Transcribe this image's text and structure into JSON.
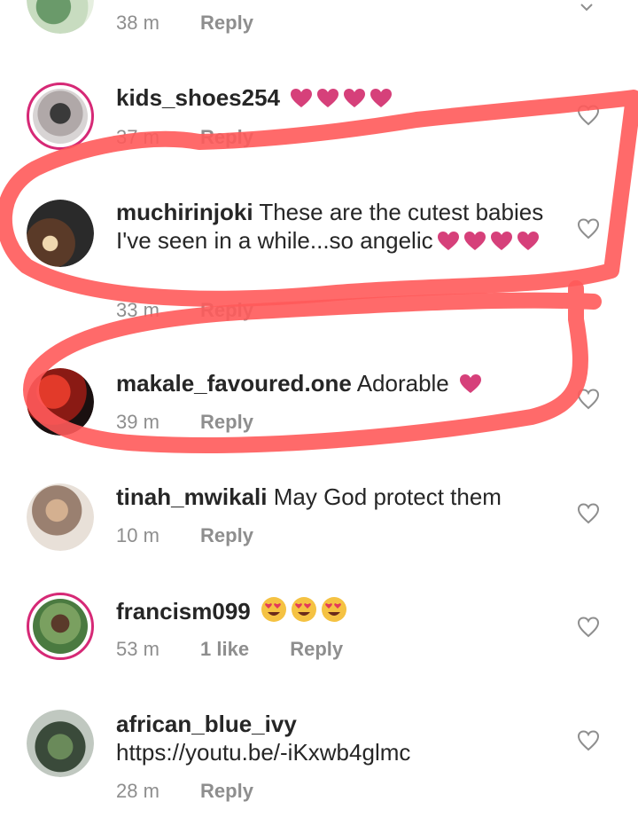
{
  "comments": [
    {
      "username": "",
      "text": "",
      "time": "38 m",
      "reply": "Reply",
      "likes": "",
      "avatar": "avatar-plant",
      "emojis": []
    },
    {
      "username": "kids_shoes254",
      "text": "",
      "time": "37 m",
      "reply": "Reply",
      "likes": "",
      "avatar": "avatar-shoes",
      "emojis": [
        "heart",
        "heart",
        "heart",
        "heart"
      ]
    },
    {
      "username": "muchirinjoki",
      "text": "These are the cutest babies I've seen in a while...so angelic",
      "time": "33 m",
      "reply": "Reply",
      "likes": "",
      "avatar": "avatar-hand",
      "emojis": [
        "heart",
        "heart",
        "heart",
        "heart"
      ]
    },
    {
      "username": "makale_favoured.one",
      "text": "Adorable",
      "time": "39 m",
      "reply": "Reply",
      "likes": "",
      "avatar": "avatar-red",
      "emojis": [
        "heart"
      ]
    },
    {
      "username": "tinah_mwikali",
      "text": "May God protect them",
      "time": "10 m",
      "reply": "Reply",
      "likes": "",
      "avatar": "avatar-woman",
      "emojis": []
    },
    {
      "username": "francism099",
      "text": "",
      "time": "53 m",
      "reply": "Reply",
      "likes": "1 like",
      "avatar": "avatar-man",
      "emojis": [
        "heart-eyes",
        "heart-eyes",
        "heart-eyes"
      ]
    },
    {
      "username": "african_blue_ivy",
      "text": "https://youtu.be/-iKxwb4glmc",
      "time": "28 m",
      "reply": "Reply",
      "likes": "",
      "avatar": "avatar-crowd",
      "emojis": []
    }
  ],
  "colors": {
    "text": "#262626",
    "meta": "#8e8e8e",
    "emoji_heart": "#d6407a",
    "story_ring": "#d62976",
    "annotation": "#ff5a5a"
  },
  "icons": {
    "like": "heart-outline-icon",
    "annotation": "red-freehand-circle"
  }
}
